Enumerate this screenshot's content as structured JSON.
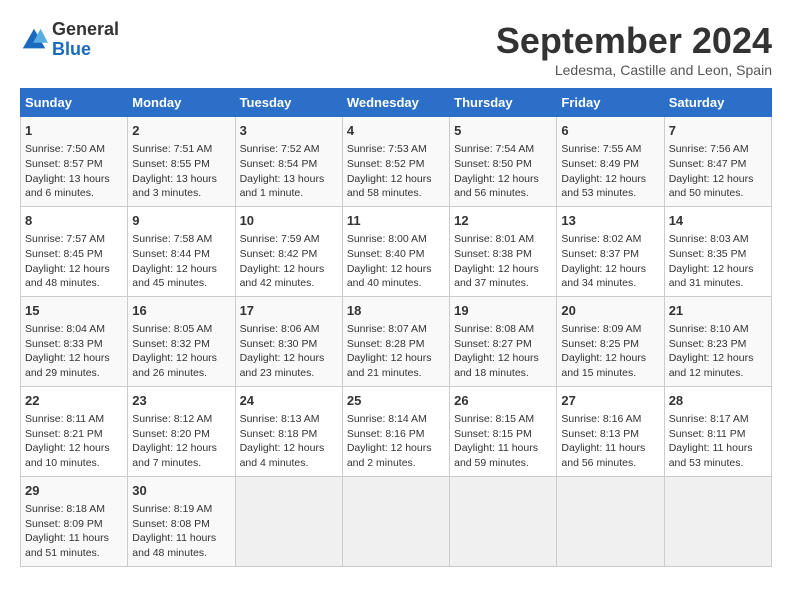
{
  "logo": {
    "general": "General",
    "blue": "Blue"
  },
  "title": "September 2024",
  "subtitle": "Ledesma, Castille and Leon, Spain",
  "headers": [
    "Sunday",
    "Monday",
    "Tuesday",
    "Wednesday",
    "Thursday",
    "Friday",
    "Saturday"
  ],
  "weeks": [
    [
      {
        "day": "1",
        "sunrise": "Sunrise: 7:50 AM",
        "sunset": "Sunset: 8:57 PM",
        "daylight": "Daylight: 13 hours and 6 minutes."
      },
      {
        "day": "2",
        "sunrise": "Sunrise: 7:51 AM",
        "sunset": "Sunset: 8:55 PM",
        "daylight": "Daylight: 13 hours and 3 minutes."
      },
      {
        "day": "3",
        "sunrise": "Sunrise: 7:52 AM",
        "sunset": "Sunset: 8:54 PM",
        "daylight": "Daylight: 13 hours and 1 minute."
      },
      {
        "day": "4",
        "sunrise": "Sunrise: 7:53 AM",
        "sunset": "Sunset: 8:52 PM",
        "daylight": "Daylight: 12 hours and 58 minutes."
      },
      {
        "day": "5",
        "sunrise": "Sunrise: 7:54 AM",
        "sunset": "Sunset: 8:50 PM",
        "daylight": "Daylight: 12 hours and 56 minutes."
      },
      {
        "day": "6",
        "sunrise": "Sunrise: 7:55 AM",
        "sunset": "Sunset: 8:49 PM",
        "daylight": "Daylight: 12 hours and 53 minutes."
      },
      {
        "day": "7",
        "sunrise": "Sunrise: 7:56 AM",
        "sunset": "Sunset: 8:47 PM",
        "daylight": "Daylight: 12 hours and 50 minutes."
      }
    ],
    [
      {
        "day": "8",
        "sunrise": "Sunrise: 7:57 AM",
        "sunset": "Sunset: 8:45 PM",
        "daylight": "Daylight: 12 hours and 48 minutes."
      },
      {
        "day": "9",
        "sunrise": "Sunrise: 7:58 AM",
        "sunset": "Sunset: 8:44 PM",
        "daylight": "Daylight: 12 hours and 45 minutes."
      },
      {
        "day": "10",
        "sunrise": "Sunrise: 7:59 AM",
        "sunset": "Sunset: 8:42 PM",
        "daylight": "Daylight: 12 hours and 42 minutes."
      },
      {
        "day": "11",
        "sunrise": "Sunrise: 8:00 AM",
        "sunset": "Sunset: 8:40 PM",
        "daylight": "Daylight: 12 hours and 40 minutes."
      },
      {
        "day": "12",
        "sunrise": "Sunrise: 8:01 AM",
        "sunset": "Sunset: 8:38 PM",
        "daylight": "Daylight: 12 hours and 37 minutes."
      },
      {
        "day": "13",
        "sunrise": "Sunrise: 8:02 AM",
        "sunset": "Sunset: 8:37 PM",
        "daylight": "Daylight: 12 hours and 34 minutes."
      },
      {
        "day": "14",
        "sunrise": "Sunrise: 8:03 AM",
        "sunset": "Sunset: 8:35 PM",
        "daylight": "Daylight: 12 hours and 31 minutes."
      }
    ],
    [
      {
        "day": "15",
        "sunrise": "Sunrise: 8:04 AM",
        "sunset": "Sunset: 8:33 PM",
        "daylight": "Daylight: 12 hours and 29 minutes."
      },
      {
        "day": "16",
        "sunrise": "Sunrise: 8:05 AM",
        "sunset": "Sunset: 8:32 PM",
        "daylight": "Daylight: 12 hours and 26 minutes."
      },
      {
        "day": "17",
        "sunrise": "Sunrise: 8:06 AM",
        "sunset": "Sunset: 8:30 PM",
        "daylight": "Daylight: 12 hours and 23 minutes."
      },
      {
        "day": "18",
        "sunrise": "Sunrise: 8:07 AM",
        "sunset": "Sunset: 8:28 PM",
        "daylight": "Daylight: 12 hours and 21 minutes."
      },
      {
        "day": "19",
        "sunrise": "Sunrise: 8:08 AM",
        "sunset": "Sunset: 8:27 PM",
        "daylight": "Daylight: 12 hours and 18 minutes."
      },
      {
        "day": "20",
        "sunrise": "Sunrise: 8:09 AM",
        "sunset": "Sunset: 8:25 PM",
        "daylight": "Daylight: 12 hours and 15 minutes."
      },
      {
        "day": "21",
        "sunrise": "Sunrise: 8:10 AM",
        "sunset": "Sunset: 8:23 PM",
        "daylight": "Daylight: 12 hours and 12 minutes."
      }
    ],
    [
      {
        "day": "22",
        "sunrise": "Sunrise: 8:11 AM",
        "sunset": "Sunset: 8:21 PM",
        "daylight": "Daylight: 12 hours and 10 minutes."
      },
      {
        "day": "23",
        "sunrise": "Sunrise: 8:12 AM",
        "sunset": "Sunset: 8:20 PM",
        "daylight": "Daylight: 12 hours and 7 minutes."
      },
      {
        "day": "24",
        "sunrise": "Sunrise: 8:13 AM",
        "sunset": "Sunset: 8:18 PM",
        "daylight": "Daylight: 12 hours and 4 minutes."
      },
      {
        "day": "25",
        "sunrise": "Sunrise: 8:14 AM",
        "sunset": "Sunset: 8:16 PM",
        "daylight": "Daylight: 12 hours and 2 minutes."
      },
      {
        "day": "26",
        "sunrise": "Sunrise: 8:15 AM",
        "sunset": "Sunset: 8:15 PM",
        "daylight": "Daylight: 11 hours and 59 minutes."
      },
      {
        "day": "27",
        "sunrise": "Sunrise: 8:16 AM",
        "sunset": "Sunset: 8:13 PM",
        "daylight": "Daylight: 11 hours and 56 minutes."
      },
      {
        "day": "28",
        "sunrise": "Sunrise: 8:17 AM",
        "sunset": "Sunset: 8:11 PM",
        "daylight": "Daylight: 11 hours and 53 minutes."
      }
    ],
    [
      {
        "day": "29",
        "sunrise": "Sunrise: 8:18 AM",
        "sunset": "Sunset: 8:09 PM",
        "daylight": "Daylight: 11 hours and 51 minutes."
      },
      {
        "day": "30",
        "sunrise": "Sunrise: 8:19 AM",
        "sunset": "Sunset: 8:08 PM",
        "daylight": "Daylight: 11 hours and 48 minutes."
      },
      null,
      null,
      null,
      null,
      null
    ]
  ]
}
